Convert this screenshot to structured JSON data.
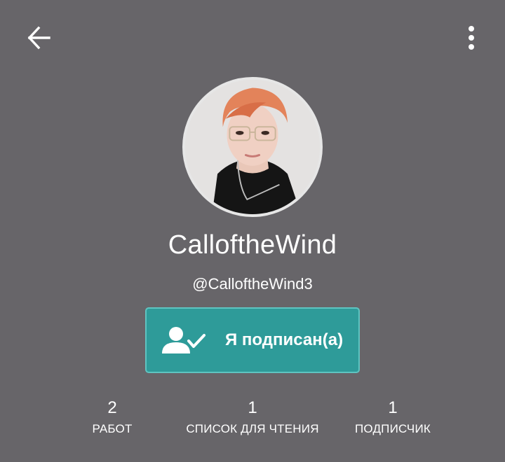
{
  "header": {
    "back_icon": "arrow-left-icon",
    "menu_icon": "more-vertical-icon"
  },
  "profile": {
    "display_name": "CalloftheWind",
    "username": "@CalloftheWind3",
    "avatar_description": "avatar-photo"
  },
  "follow_button": {
    "label": "Я подписан(а)",
    "icon": "user-check-icon",
    "color": "#2e9b99"
  },
  "stats": [
    {
      "value": "2",
      "label": "РАБОТ"
    },
    {
      "value": "1",
      "label": "СПИСОК ДЛЯ ЧТЕНИЯ"
    },
    {
      "value": "1",
      "label": "ПОДПИСЧИК"
    }
  ],
  "colors": {
    "background": "#676569",
    "accent": "#2e9b99"
  }
}
